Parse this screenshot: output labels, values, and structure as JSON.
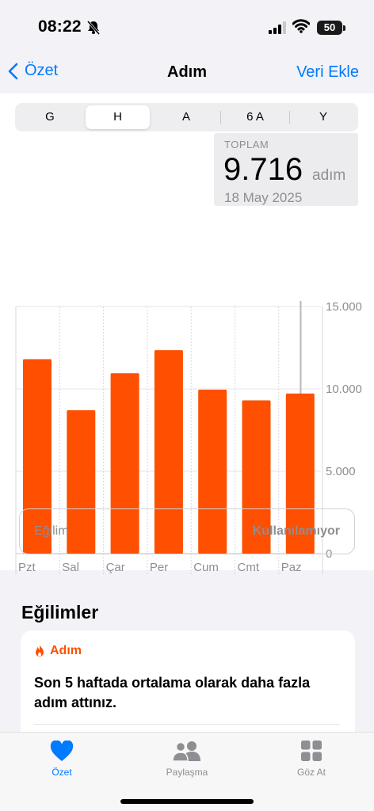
{
  "status": {
    "time": "08:22",
    "battery": "50"
  },
  "nav": {
    "back": "Özet",
    "title": "Adım",
    "add": "Veri Ekle"
  },
  "segments": [
    {
      "label": "G",
      "selected": false
    },
    {
      "label": "H",
      "selected": true
    },
    {
      "label": "A",
      "selected": false
    },
    {
      "label": "6 A",
      "selected": false
    },
    {
      "label": "Y",
      "selected": false
    }
  ],
  "callout": {
    "label": "TOPLAM",
    "value": "9.716",
    "unit": "adım",
    "date": "18 May 2025"
  },
  "trend_row": {
    "label": "Eğilim",
    "status": "Kullanılamıyor"
  },
  "trends_section": {
    "title": "Eğilimler",
    "card": {
      "category": "Adım",
      "message": "Son 5 haftada ortalama olarak daha fazla adım attınız."
    }
  },
  "tabbar": {
    "tabs": [
      "Özet",
      "Paylaşma",
      "Göz At"
    ]
  },
  "colors": {
    "accent": "#007aff",
    "bar": "#ff4f00",
    "grid": "#e5e5ea"
  },
  "chart_data": {
    "type": "bar",
    "categories": [
      "Pzt",
      "Sal",
      "Çar",
      "Per",
      "Cum",
      "Cmt",
      "Paz"
    ],
    "values": [
      11800,
      8700,
      10950,
      12350,
      9950,
      9300,
      9716
    ],
    "y_ticks": [
      "15.000",
      "10.000",
      "5.000",
      "0"
    ],
    "ylim": [
      0,
      15000
    ],
    "highlighted_index": 6
  }
}
